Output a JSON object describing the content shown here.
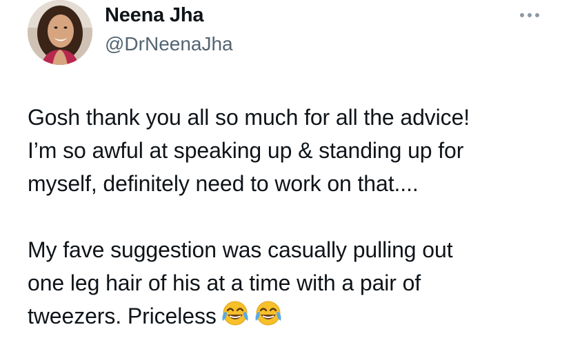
{
  "tweet": {
    "author": {
      "display_name": "Neena Jha",
      "handle": "@DrNeenaJha",
      "avatar_icon": "profile-photo"
    },
    "more_icon": "ellipsis-icon",
    "body": {
      "paragraph_1": "Gosh thank you all so much for all the advice!\nI’m so awful at speaking up & standing up for\nmyself, definitely need to work on that....",
      "paragraph_2": "My fave suggestion was casually pulling out\none leg hair of his at a time with a pair of\ntweezers. Priceless",
      "emojis": [
        "face-with-tears-of-joy",
        "face-with-tears-of-joy"
      ]
    }
  },
  "colors": {
    "text_primary": "#0f1419",
    "text_secondary": "#536471",
    "background": "#ffffff"
  }
}
